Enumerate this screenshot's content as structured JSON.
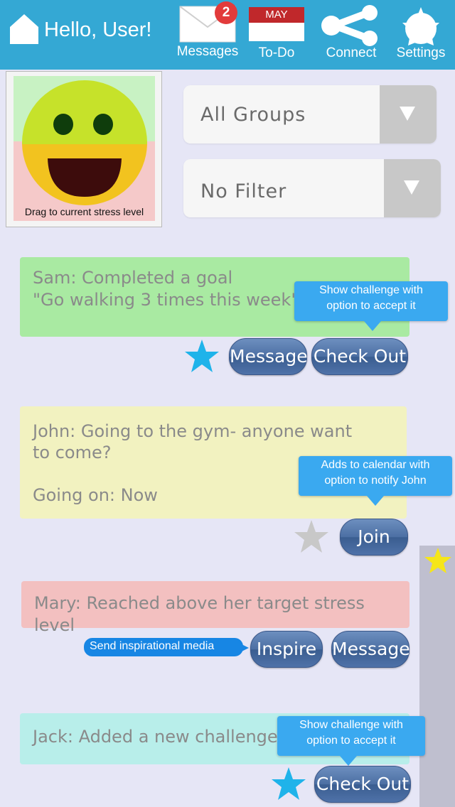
{
  "header": {
    "greeting": "Hello, User!",
    "nav": [
      {
        "label": "Messages",
        "icon": "envelope-icon",
        "badge": "2"
      },
      {
        "label": "To-Do",
        "icon": "calendar-icon",
        "calendar_month": "MAY"
      },
      {
        "label": "Connect",
        "icon": "share-icon"
      },
      {
        "label": "Settings",
        "icon": "gear-icon"
      }
    ]
  },
  "mood": {
    "caption": "Drag to current stress level",
    "icon": "smiley-face-icon"
  },
  "filters": {
    "group": "All Groups",
    "filter": "No Filter"
  },
  "feed": [
    {
      "text": "Sam: Completed a goal\n\"Go walking 3 times this week\"",
      "color": "#a9eaa2",
      "star": "starred",
      "buttons": [
        "Message",
        "Check Out"
      ],
      "callout": "Show challenge with\noption to accept it"
    },
    {
      "text": "John: Going to the gym- anyone want\nto come?\n\nGoing on: Now",
      "color": "#f2f2c0",
      "star": "unstarred",
      "buttons": [
        "Join"
      ],
      "callout": "Adds to calendar with\noption to notify John"
    },
    {
      "text": "Mary: Reached above her target stress level",
      "color": "#f3c0c0",
      "buttons": [
        "Inspire",
        "Message"
      ],
      "callout": "Send inspirational media"
    },
    {
      "text": "Jack: Added a new challenge",
      "color": "#b8eeea",
      "star": "starred",
      "buttons": [
        "Check Out"
      ],
      "callout": "Show challenge with\noption to accept it"
    }
  ],
  "side_panel": {
    "star": "starred-gold"
  },
  "colors": {
    "topbar": "#34a8d4",
    "background": "#e6e6f6",
    "button": "#4c6fa3",
    "star_blue": "#1fb3ea",
    "star_gray": "#c8c8c8",
    "star_gold": "#f6e619",
    "callout": "#3aa9f0"
  }
}
